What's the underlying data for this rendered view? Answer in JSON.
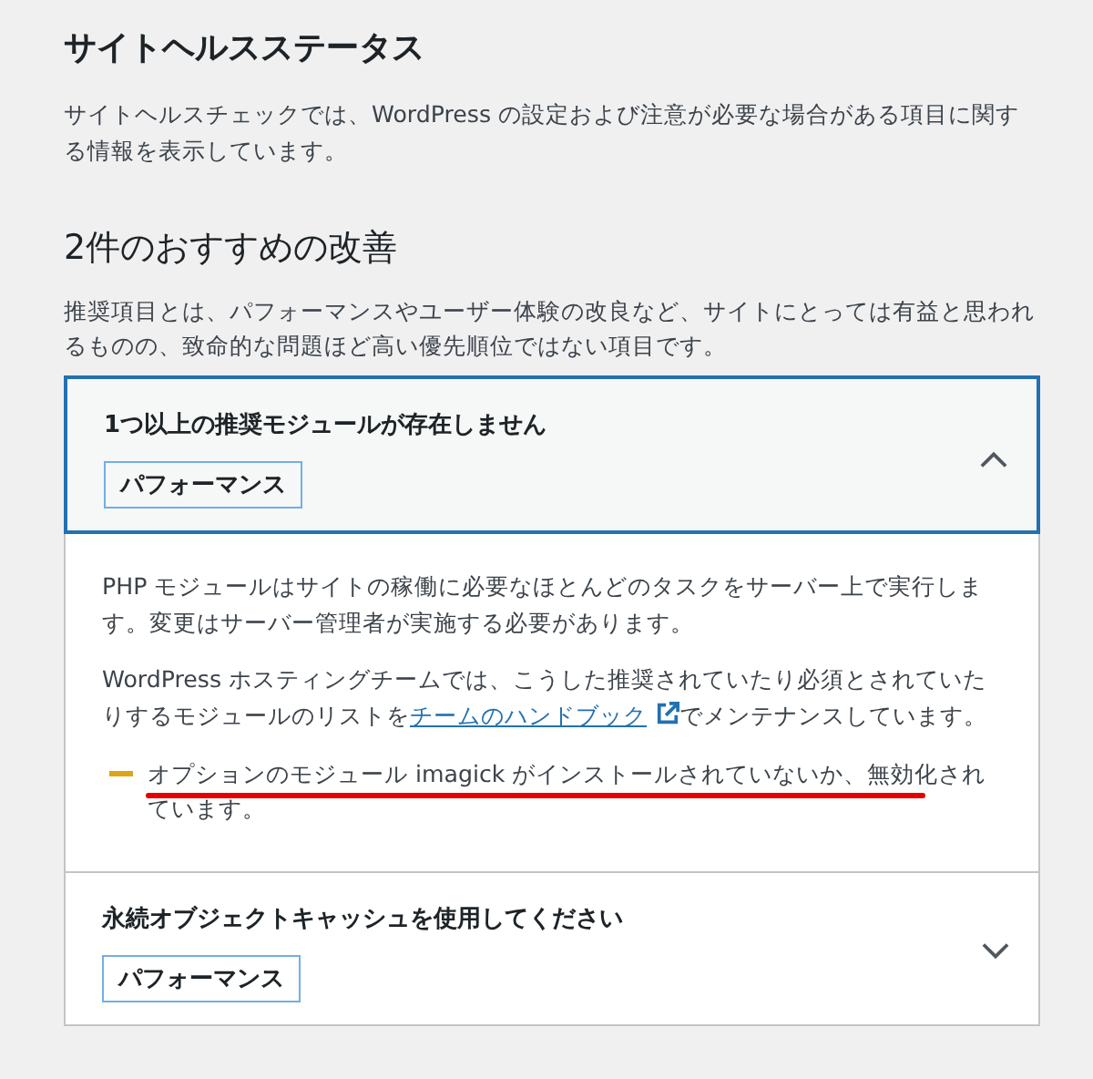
{
  "heading": "サイトヘルスステータス",
  "intro": "サイトヘルスチェックでは、WordPress の設定および注意が必要な場合がある項目に関する情報を表示しています。",
  "section": {
    "title": "2件のおすすめの改善",
    "description": "推奨項目とは、パフォーマンスやユーザー体験の改良など、サイトにとっては有益と思われるものの、致命的な問題ほど高い優先順位ではない項目です。"
  },
  "issues": [
    {
      "title": "1つ以上の推奨モジュールが存在しません",
      "badge": "パフォーマンス",
      "expanded": true,
      "details": [
        {
          "kind": "text",
          "text": "PHP モジュールはサイトの稼働に必要なほとんどのタスクをサーバー上で実行します。変更はサーバー管理者が実施する必要があります。"
        },
        {
          "kind": "link_text",
          "before": "WordPress ホスティングチームでは、こうした推奨されていたり必須とされていたりするモジュールのリストを",
          "link": "チームのハンドブック",
          "after": "でメンテナンスしています。"
        },
        {
          "kind": "warning",
          "text": "オプションのモジュール imagick がインストールされていないか、無効化されています。",
          "underlined": true
        }
      ]
    },
    {
      "title": "永続オブジェクトキャッシュを使用してください",
      "badge": "パフォーマンス",
      "expanded": false
    }
  ]
}
